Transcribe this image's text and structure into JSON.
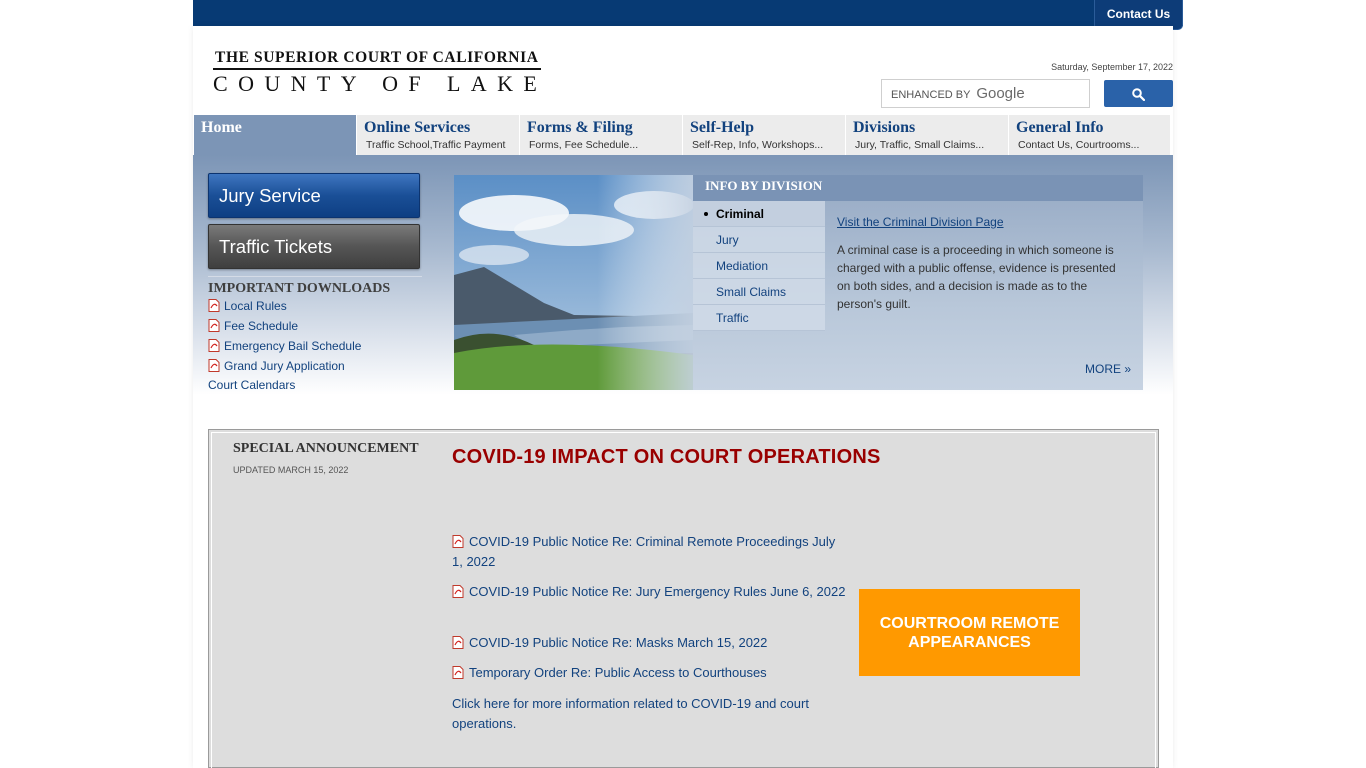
{
  "header": {
    "contact_label": "Contact Us",
    "logo_line1": "THE SUPERIOR COURT OF CALIFORNIA",
    "logo_line2": "COUNTY OF LAKE",
    "date": "Saturday, September 17, 2022",
    "search_enhanced": "ENHANCED BY",
    "search_google": "Google",
    "search_icon": "magnifier-icon"
  },
  "nav": [
    {
      "title": "Home",
      "sub": ""
    },
    {
      "title": "Online Services",
      "sub": "Traffic School,Traffic Payment"
    },
    {
      "title": "Forms & Filing",
      "sub": "Forms, Fee Schedule..."
    },
    {
      "title": "Self-Help",
      "sub": "Self-Rep, Info, Workshops..."
    },
    {
      "title": "Divisions",
      "sub": "Jury, Traffic, Small Claims..."
    },
    {
      "title": "General Info",
      "sub": "Contact Us, Courtrooms..."
    }
  ],
  "sidebar": {
    "jury_label": "Jury Service",
    "traffic_label": "Traffic Tickets",
    "downloads_title": "IMPORTANT DOWNLOADS",
    "downloads": [
      "Local Rules",
      "Fee Schedule",
      "Emergency Bail Schedule",
      "Grand Jury Application"
    ],
    "court_calendars": "Court Calendars"
  },
  "info": {
    "header": "INFO BY DIVISION",
    "tabs": [
      "Criminal",
      "Jury",
      "Mediation",
      "Small Claims",
      "Traffic"
    ],
    "active_tab": "Criminal",
    "link": "Visit the Criminal Division Page",
    "text": "A criminal case is a proceeding in which someone is charged with a public offense, evidence is presented on both sides, and a decision is made as to the person's guilt.",
    "more": "MORE »"
  },
  "announcement": {
    "title": "SPECIAL ANNOUNCEMENT",
    "updated": "UPDATED MARCH 15, 2022",
    "heading": "COVID-19 IMPACT ON COURT OPERATIONS",
    "notices": [
      "COVID-19 Public Notice Re: Criminal Remote Proceedings July 1, 2022",
      "COVID-19 Public Notice Re: Jury Emergency Rules June 6, 2022",
      "COVID-19 Public Notice Re: Masks March 15, 2022",
      "Temporary Order Re: Public Access to Courthouses"
    ],
    "more_info": "Click here for more information related to COVID-19 and court operations.",
    "remote_button": "COURTROOM REMOTE APPEARANCES"
  },
  "colors": {
    "brand_navy": "#073a74",
    "link_blue": "#12427e",
    "heading_red": "#990000",
    "orange": "#ff9900"
  }
}
